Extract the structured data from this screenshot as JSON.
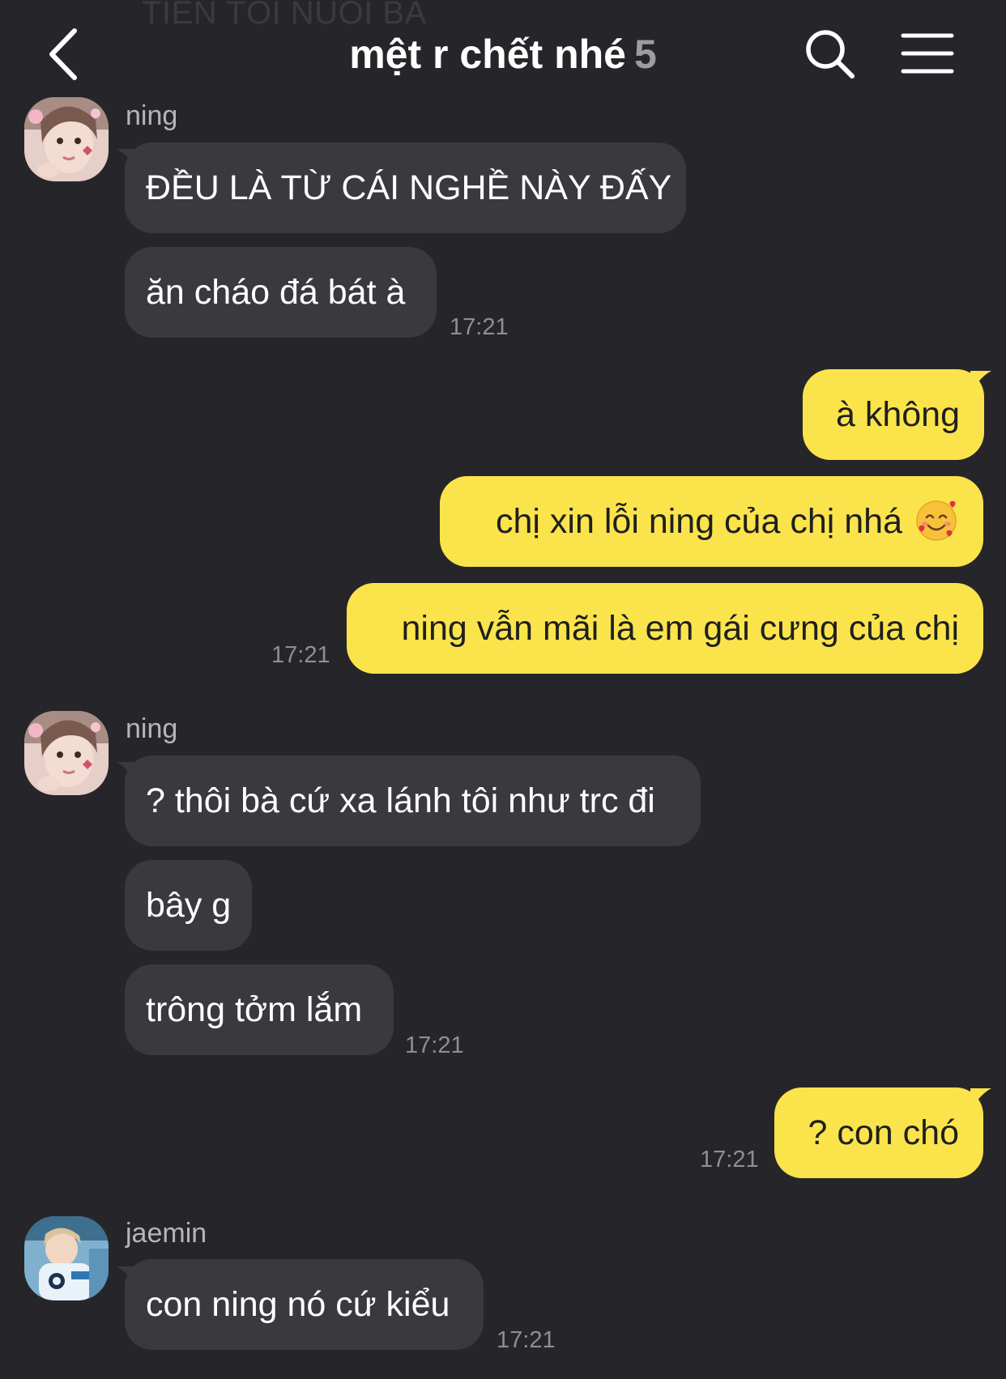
{
  "ghost_text": "TIỀN TÔI NUÔI BÀ",
  "header": {
    "title": "mệt r chết nhé",
    "member_count": "5"
  },
  "colors": {
    "background": "#26262a",
    "incoming_bubble": "#3a3a3e",
    "outgoing_bubble": "#fbe44b",
    "timestamp": "#8e8e95"
  },
  "groups": [
    {
      "sender": "ning",
      "messages": [
        "ĐỀU LÀ TỪ CÁI NGHỀ NÀY ĐẤY",
        "ăn cháo đá bát à"
      ],
      "time": "17:21"
    },
    {
      "sender": "me",
      "messages": [
        "à không",
        "chị xin lỗi ning của chị nhá",
        "ning vẫn mãi là em gái cưng của chị"
      ],
      "emoji": "smiling-face-with-hearts",
      "time": "17:21"
    },
    {
      "sender": "ning",
      "messages": [
        "? thôi bà cứ xa lánh tôi như trc đi",
        "bây g",
        "trông tởm lắm"
      ],
      "time": "17:21"
    },
    {
      "sender": "me",
      "messages": [
        "? con chó"
      ],
      "time": "17:21"
    },
    {
      "sender": "jaemin",
      "messages": [
        "con ning nó cứ kiểu"
      ],
      "time": "17:21"
    }
  ]
}
